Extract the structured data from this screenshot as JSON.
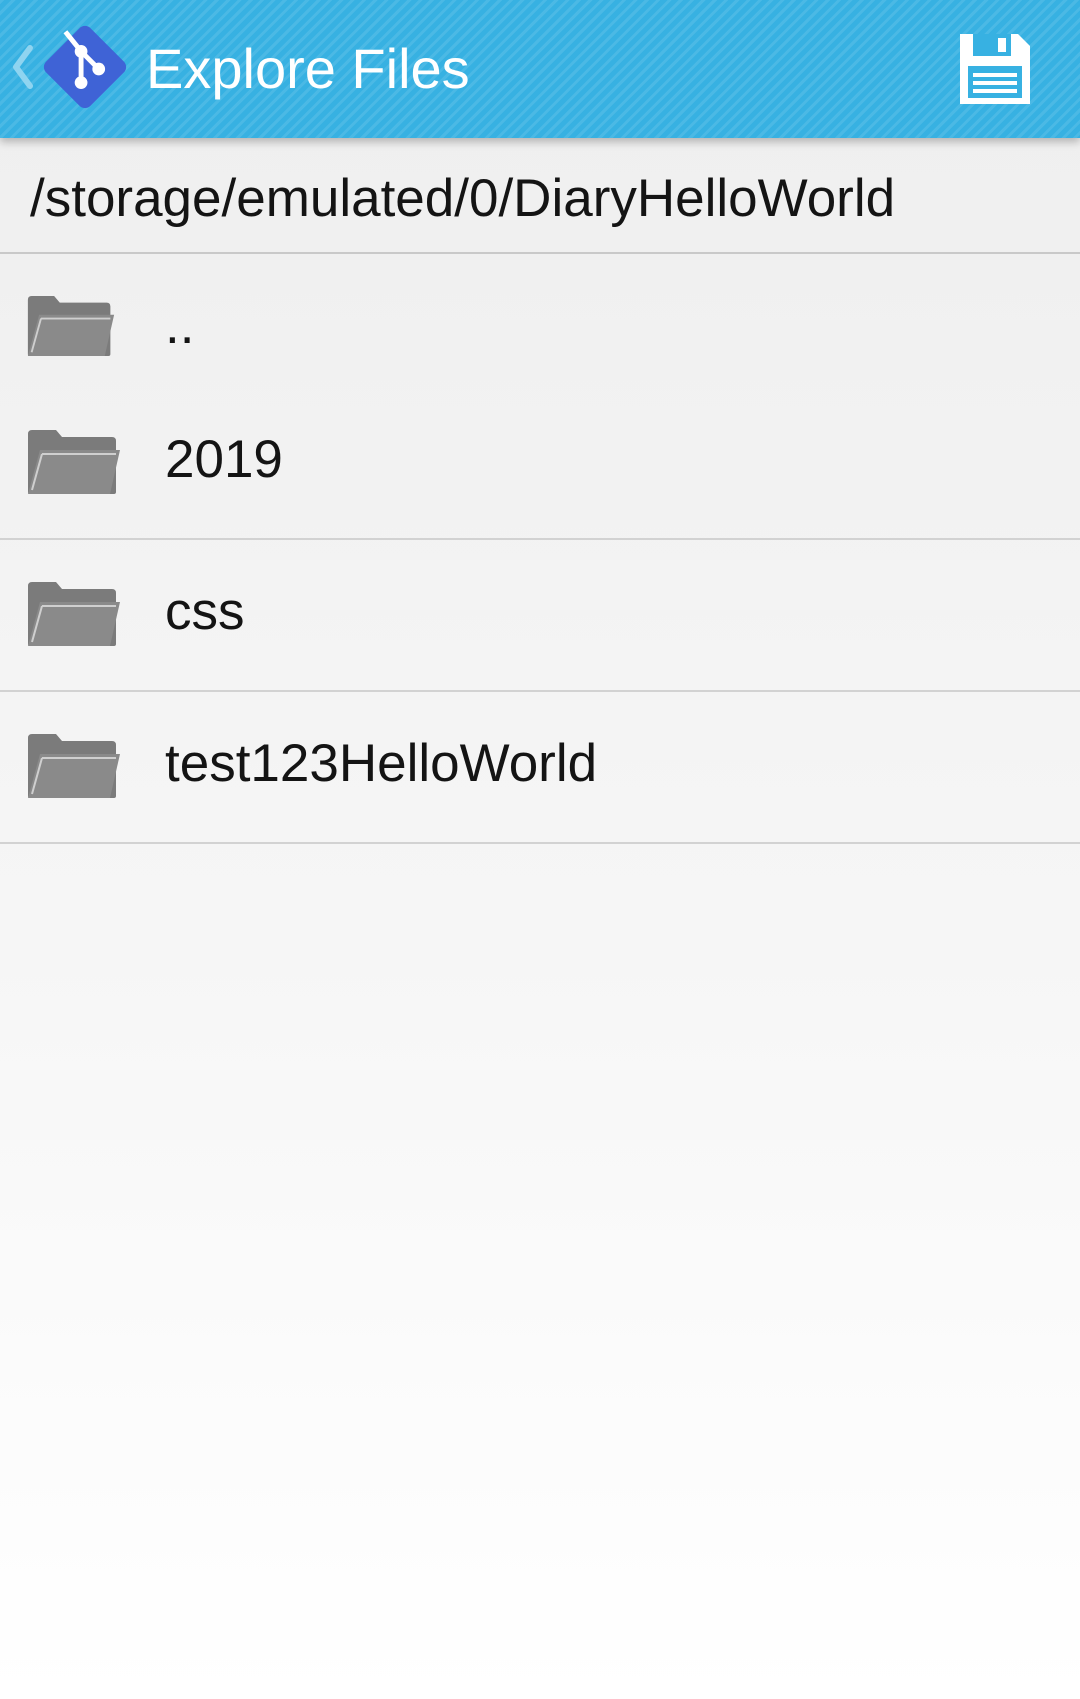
{
  "app_bar": {
    "title": "Explore Files",
    "back_icon": "chevron-left-icon",
    "logo_icon": "git-logo-icon",
    "save_icon": "floppy-disk-icon",
    "background_color": "#37b1e2",
    "logo_color": "#3f63d6"
  },
  "path_bar": {
    "current_path": "/storage/emulated/0/DiaryHelloWorld"
  },
  "file_list": {
    "items": [
      {
        "name": "..",
        "icon": "folder-icon"
      },
      {
        "name": "2019",
        "icon": "folder-icon"
      },
      {
        "name": "css",
        "icon": "folder-icon"
      },
      {
        "name": "test123HelloWorld",
        "icon": "folder-icon"
      }
    ]
  }
}
